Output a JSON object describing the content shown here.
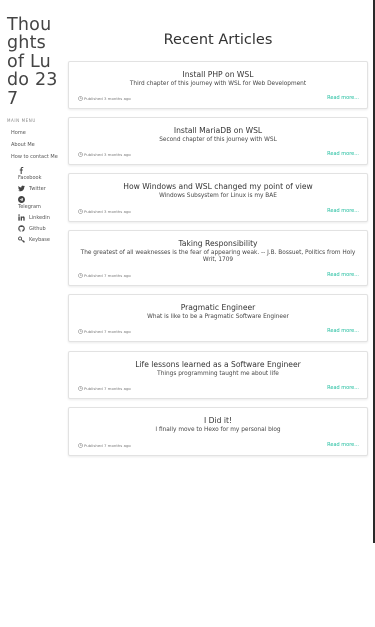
{
  "sidebar": {
    "site_title": "Thoughts of Ludo 237",
    "menu_heading": "MAIN MENU",
    "nav": [
      {
        "label": "Home"
      },
      {
        "label": "About Me"
      },
      {
        "label": "How to contact Me"
      }
    ],
    "social": [
      {
        "label": "Facebook",
        "icon": "facebook-icon"
      },
      {
        "label": "Twitter",
        "icon": "twitter-icon"
      },
      {
        "label": "Telegram",
        "icon": "telegram-icon"
      },
      {
        "label": "Linkedin",
        "icon": "linkedin-icon"
      },
      {
        "label": "Github",
        "icon": "github-icon"
      },
      {
        "label": "Keybase",
        "icon": "key-icon"
      }
    ]
  },
  "main": {
    "page_title": "Recent Articles",
    "articles": [
      {
        "title": "Install PHP on WSL",
        "subtitle": "Third chapter of this journey with WSL for Web Development",
        "published": "Published 3 months ago",
        "read_more": "Read more..."
      },
      {
        "title": "Install MariaDB on WSL",
        "subtitle": "Second chapter of this journey with WSL",
        "published": "Published 3 months ago",
        "read_more": "Read more..."
      },
      {
        "title": "How Windows and WSL changed my point of view",
        "subtitle": "Windows Subsystem for Linux is my BAE",
        "published": "Published 3 months ago",
        "read_more": "Read more..."
      },
      {
        "title": "Taking Responsibility",
        "subtitle": "The greatest of all weaknesses is the fear of appearing weak. -- J.B. Bossuet, Politics from Holy Writ, 1709",
        "published": "Published 7 months ago",
        "read_more": "Read more..."
      },
      {
        "title": "Pragmatic Engineer",
        "subtitle": "What is like to be a Pragmatic Software Engineer",
        "published": "Published 7 months ago",
        "read_more": "Read more..."
      },
      {
        "title": "Life lessons learned as a Software Engineer",
        "subtitle": "Things programming taught me about life",
        "published": "Published 7 months ago",
        "read_more": "Read more..."
      },
      {
        "title": "I Did it!",
        "subtitle": "I finally move to Hexo for my personal blog",
        "published": "Published 7 months ago",
        "read_more": "Read more..."
      }
    ]
  },
  "colors": {
    "accent": "#1abc9c",
    "text": "#333333",
    "card_border": "#e2e2e2"
  }
}
